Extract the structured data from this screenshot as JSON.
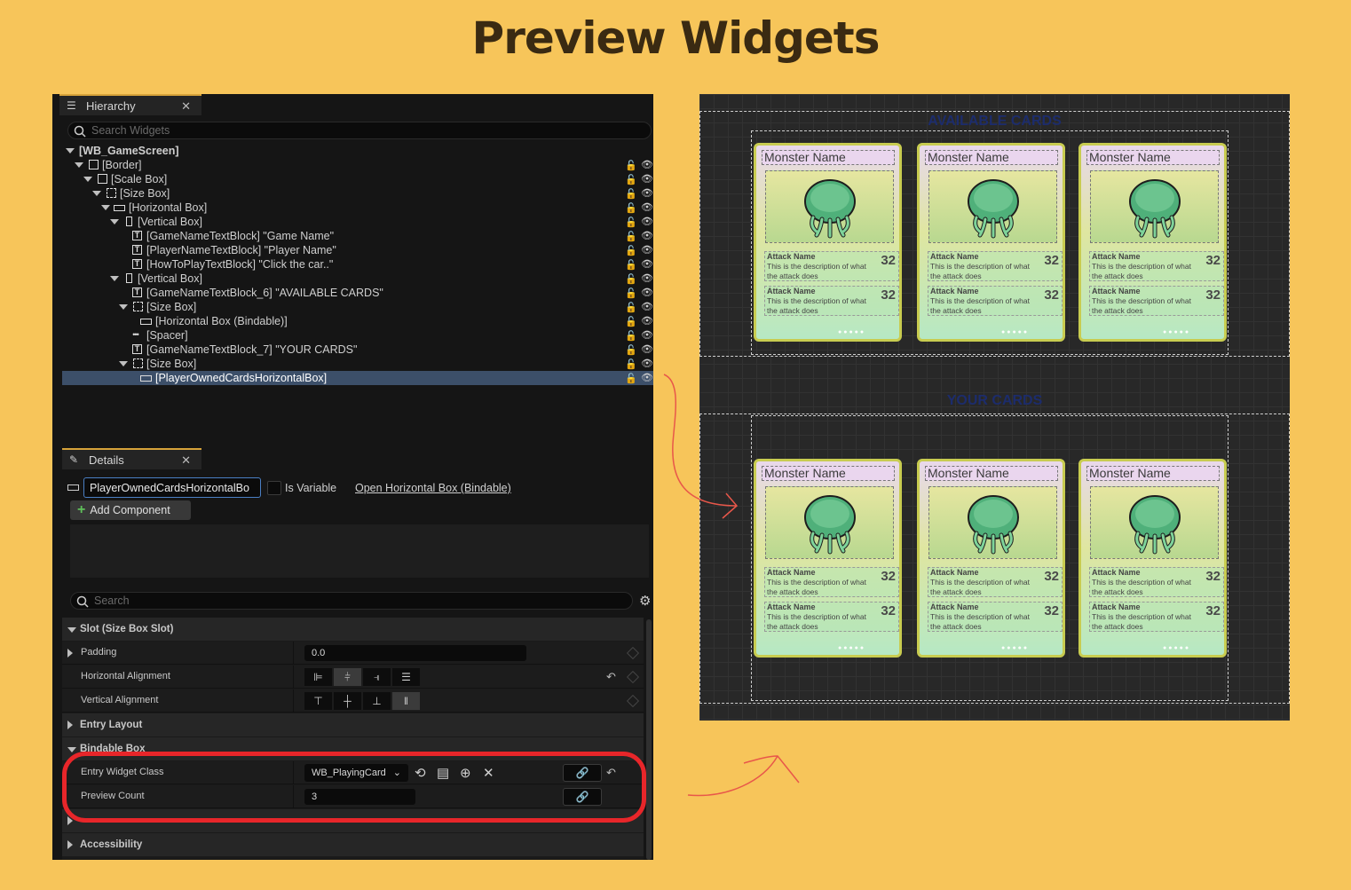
{
  "page": {
    "title": "Preview Widgets"
  },
  "hierarchy": {
    "tab_label": "Hierarchy",
    "search_placeholder": "Search Widgets",
    "items": [
      {
        "label": "[WB_GameScreen]"
      },
      {
        "label": "[Border]"
      },
      {
        "label": "[Scale Box]"
      },
      {
        "label": "[Size Box]"
      },
      {
        "label": "[Horizontal Box]"
      },
      {
        "label": "[Vertical Box]"
      },
      {
        "label": "[GameNameTextBlock] \"Game Name\""
      },
      {
        "label": "[PlayerNameTextBlock] \"Player Name\""
      },
      {
        "label": "[HowToPlayTextBlock] \"Click the car..\""
      },
      {
        "label": "[Vertical Box]"
      },
      {
        "label": "[GameNameTextBlock_6] \"AVAILABLE CARDS\""
      },
      {
        "label": "[Size Box]"
      },
      {
        "label": "[Horizontal Box (Bindable)]"
      },
      {
        "label": "[Spacer]"
      },
      {
        "label": "[GameNameTextBlock_7] \"YOUR CARDS\""
      },
      {
        "label": "[Size Box]"
      },
      {
        "label": "[PlayerOwnedCardsHorizontalBox]"
      }
    ]
  },
  "details": {
    "tab_label": "Details",
    "name_value": "PlayerOwnedCardsHorizontalBo",
    "is_variable_label": "Is Variable",
    "open_link": "Open Horizontal Box (Bindable)",
    "add_component": "Add Component",
    "search_placeholder": "Search",
    "sections": {
      "slot": "Slot (Size Box Slot)",
      "entry_layout": "Entry Layout",
      "bindable_box": "Bindable Box",
      "accessibility": "Accessibility"
    },
    "props": {
      "padding": {
        "label": "Padding",
        "value": "0.0"
      },
      "h_align": {
        "label": "Horizontal Alignment"
      },
      "v_align": {
        "label": "Vertical Alignment"
      },
      "entry_widget_class": {
        "label": "Entry Widget Class",
        "value": "WB_PlayingCard"
      },
      "preview_count": {
        "label": "Preview Count",
        "value": "3"
      }
    }
  },
  "preview": {
    "available_label": "AVAILABLE CARDS",
    "your_label": "YOUR CARDS",
    "card": {
      "name": "Monster Name",
      "attack_name": "Attack Name",
      "attack_desc": "This is the description of what the attack does",
      "attack_value": "32"
    }
  },
  "colors": {
    "background": "#f7c55a",
    "highlight": "#e8262a",
    "arrow": "#e8574a",
    "selection": "#3c4f69"
  }
}
